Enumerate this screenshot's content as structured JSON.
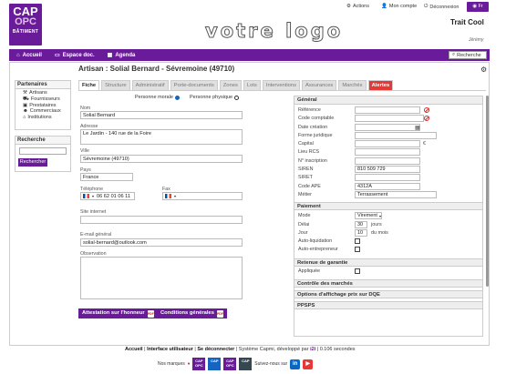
{
  "header": {
    "logo": {
      "line1": "CAP",
      "line2": "OPC",
      "line3": "BÂTIMENT"
    },
    "logo_placeholder": "votre logo",
    "actions_label": "Actions",
    "account_label": "Mon compte",
    "logout_label": "Déconnexion",
    "lang_label": "Fr",
    "company_name": "Trait Cool",
    "user_name": "Jérémy"
  },
  "navbar": {
    "items": [
      "Accueil",
      "Espace doc.",
      "Agenda"
    ],
    "search_label": "Recherche"
  },
  "sidebar": {
    "partners_title": "Partenaires",
    "partners": [
      "Artisans",
      "Fournisseurs",
      "Prestataires",
      "Commerciaux",
      "Institutions"
    ],
    "search_title": "Recherche",
    "search_button": "Rechercher"
  },
  "page": {
    "title": "Artisan : Solial Bernard - Sévremoine (49710)",
    "tabs": [
      "Fiche",
      "Structure",
      "Administratif",
      "Porte-documents",
      "Zones",
      "Lots",
      "Interventions",
      "Assurances",
      "Marchés",
      "Alertes"
    ]
  },
  "form": {
    "person_type": {
      "moral_label": "Personne morale",
      "physical_label": "Personne physique",
      "selected": "Personne morale"
    },
    "nom_label": "Nom",
    "nom_value": "Solial Bernard",
    "adresse_label": "Adresse",
    "adresse_value": "Le Jardin - 140 rue de la Foire",
    "ville_label": "Ville",
    "ville_value": "Sévremoine (49710)",
    "pays_label": "Pays",
    "pays_value": "France",
    "telephone_label": "Téléphone",
    "telephone_value": "06 62 01 06 11",
    "fax_label": "Fax",
    "site_label": "Site internet",
    "email_label": "E-mail général",
    "email_value": "solial-bernard@outlook.com",
    "observation_label": "Observation",
    "btn_attestation": "Attestation sur l'honneur",
    "btn_conditions": "Conditions générales"
  },
  "general": {
    "title": "Général",
    "rows": [
      {
        "label": "Référence",
        "value": ""
      },
      {
        "label": "Code comptable",
        "value": ""
      },
      {
        "label": "Date création",
        "value": ""
      },
      {
        "label": "Forme juridique",
        "value": ""
      },
      {
        "label": "Capital",
        "value": "",
        "unit": "€"
      },
      {
        "label": "Lieu RCS",
        "value": ""
      },
      {
        "label": "N° inscription",
        "value": ""
      },
      {
        "label": "SIREN",
        "value": "810 509 729"
      },
      {
        "label": "SIRET",
        "value": ""
      },
      {
        "label": "Code APE",
        "value": "4312A"
      },
      {
        "label": "Métier",
        "value": "Terrassement"
      }
    ]
  },
  "paiement": {
    "title": "Paiement",
    "mode_label": "Mode",
    "mode_value": "Virement",
    "delai_label": "Délai",
    "delai_value": "30",
    "delai_unit": "jours",
    "jour_label": "Jour",
    "jour_value": "10",
    "jour_unit": "du mois",
    "auto_liquidation_label": "Auto-liquidation",
    "auto_entrepreneur_label": "Auto-entrepreneur"
  },
  "retenue": {
    "title": "Retenue de garantie",
    "appliquee_label": "Appliquée"
  },
  "sections": {
    "controle": "Contrôle des marchés",
    "options": "Options d'affichage prix sur DQE",
    "ppsps": "PPSPS"
  },
  "footer": {
    "links": [
      "Accueil",
      "Interface utilisateur",
      "Se déconnecter"
    ],
    "powered": "Système Capmi, développé par",
    "version": "0.106 secondes",
    "brands_label": "Nos marques",
    "follow_label": "Suivez-nous sur"
  },
  "colors": {
    "brand": "#6a1b9a",
    "alert_tab": "#e53935"
  }
}
